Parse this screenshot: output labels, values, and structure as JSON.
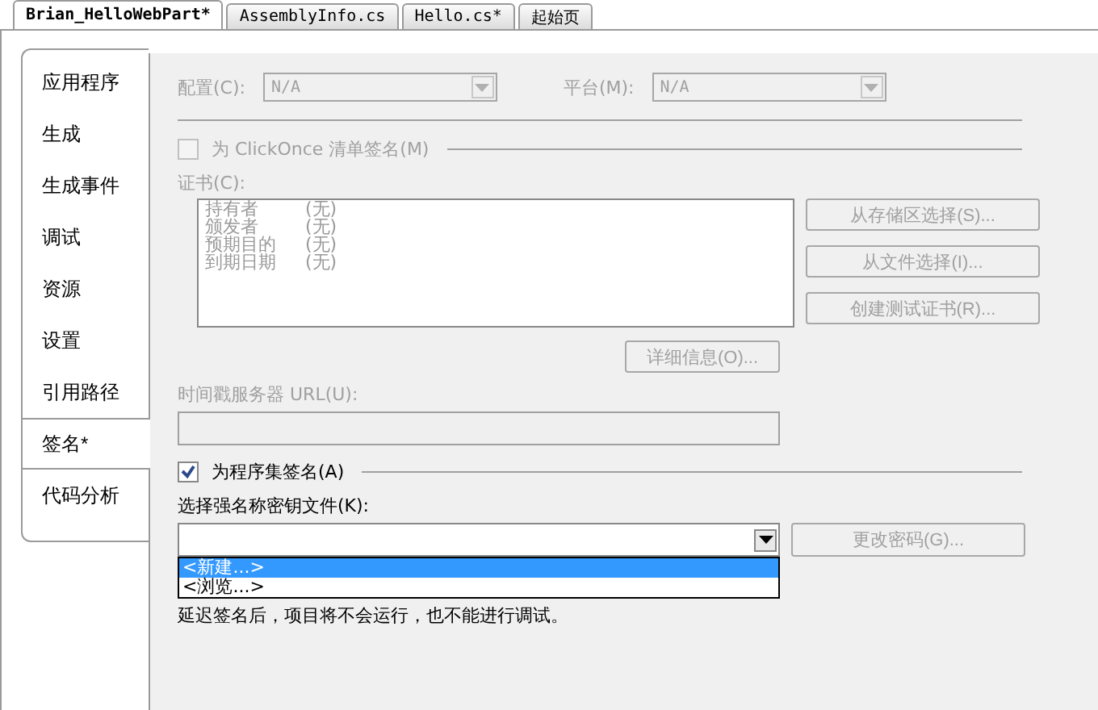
{
  "tabs": [
    {
      "label": "Brian_HelloWebPart*",
      "selected": true
    },
    {
      "label": "AssemblyInfo.cs",
      "selected": false
    },
    {
      "label": "Hello.cs*",
      "selected": false
    },
    {
      "label": "起始页",
      "selected": false
    }
  ],
  "side_tabs": [
    {
      "label": "应用程序",
      "selected": false
    },
    {
      "label": "生成",
      "selected": false
    },
    {
      "label": "生成事件",
      "selected": false
    },
    {
      "label": "调试",
      "selected": false
    },
    {
      "label": "资源",
      "selected": false
    },
    {
      "label": "设置",
      "selected": false
    },
    {
      "label": "引用路径",
      "selected": false
    },
    {
      "label": "签名*",
      "selected": true
    },
    {
      "label": "代码分析",
      "selected": false
    }
  ],
  "config": {
    "label": "配置(C):",
    "value": "N/A",
    "disabled": true
  },
  "platform": {
    "label": "平台(M):",
    "value": "N/A",
    "disabled": true
  },
  "clickonce": {
    "label": "为 ClickOnce 清单签名(M)",
    "checked": false,
    "disabled": true
  },
  "certificate": {
    "label": "证书(C):",
    "rows": [
      {
        "name": "持有者",
        "value": "(无)"
      },
      {
        "name": "颁发者",
        "value": "(无)"
      },
      {
        "name": "预期目的",
        "value": "(无)"
      },
      {
        "name": "到期日期",
        "value": "(无)"
      }
    ]
  },
  "cert_buttons": [
    "从存储区选择(S)...",
    "从文件选择(I)...",
    "创建测试证书(R)..."
  ],
  "details_button": "详细信息(O)...",
  "timestamp": {
    "label": "时间戳服务器 URL(U):",
    "disabled": true
  },
  "sign_assembly": {
    "label": "为程序集签名(A)",
    "checked": true
  },
  "key_file": {
    "label": "选择强名称密钥文件(K):",
    "options": [
      {
        "label": "<新建...>",
        "selected": true
      },
      {
        "label": "<浏览...>",
        "selected": false
      }
    ]
  },
  "change_password_button": "更改密码(G)...",
  "note": "延迟签名后，项目将不会运行，也不能进行调试。"
}
